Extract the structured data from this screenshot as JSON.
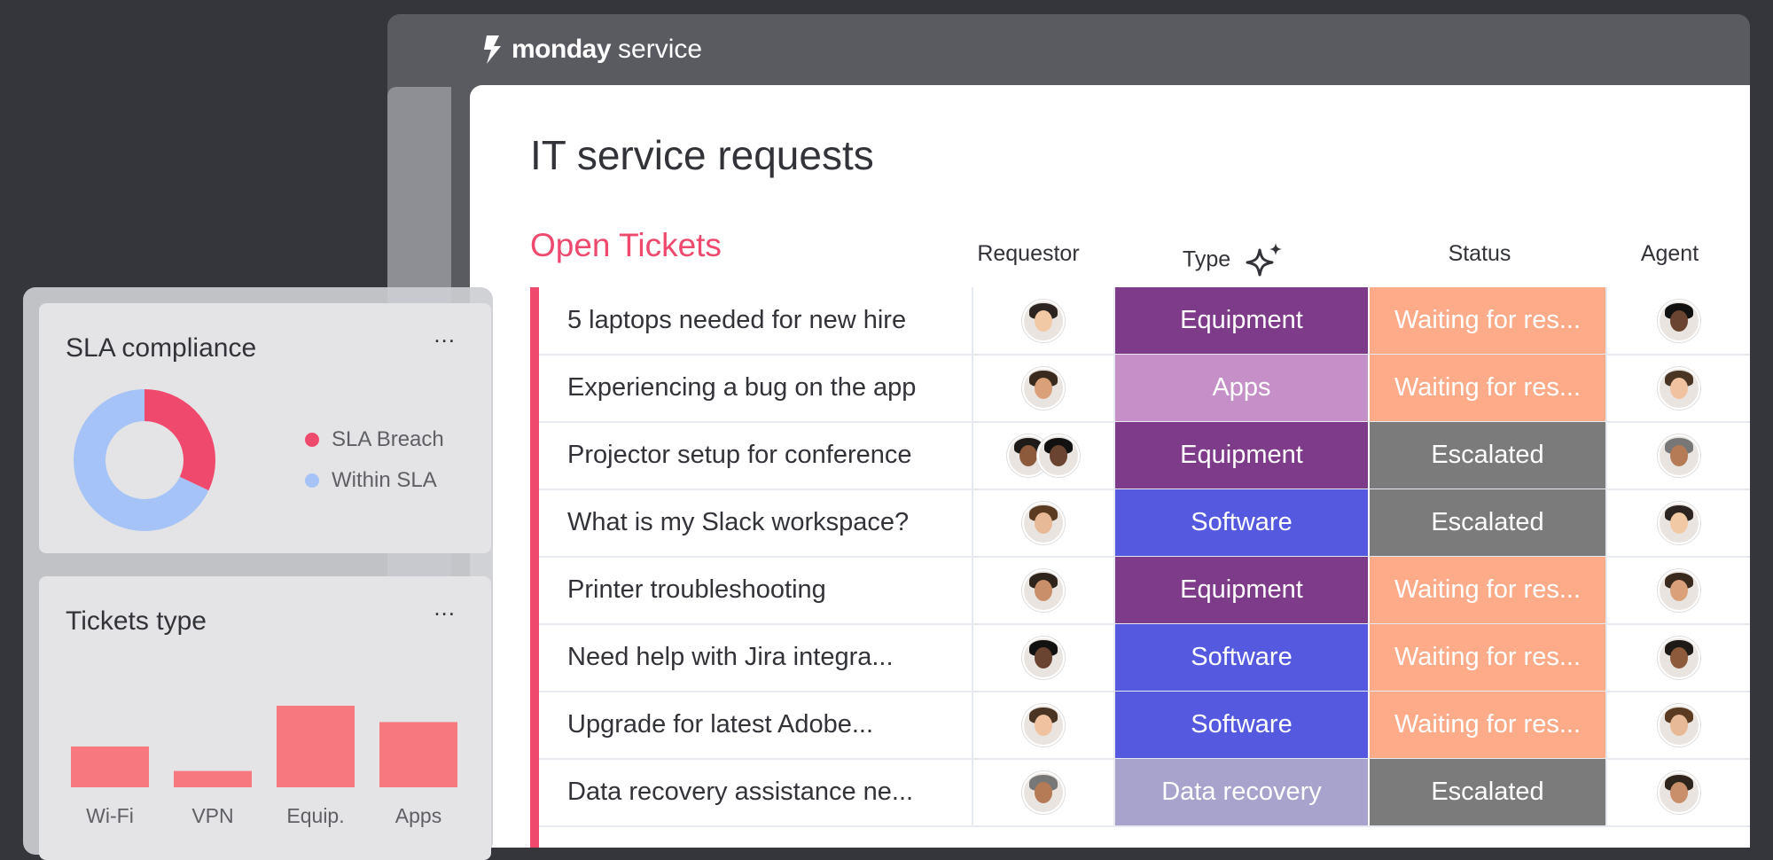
{
  "app": {
    "brand": "monday",
    "product": "service"
  },
  "board": {
    "title": "IT service requests"
  },
  "group": {
    "title": "Open Tickets"
  },
  "columns": {
    "requestor": "Requestor",
    "type": "Type",
    "status": "Status",
    "agent": "Agent"
  },
  "rows": [
    {
      "name": "5 laptops needed for new hire",
      "type": "Equipment",
      "status": "Waiting for res..."
    },
    {
      "name": "Experiencing a bug on the app",
      "type": "Apps",
      "status": "Waiting for res..."
    },
    {
      "name": "Projector setup for conference",
      "type": "Equipment",
      "status": "Escalated"
    },
    {
      "name": "What is my Slack workspace?",
      "type": "Software",
      "status": "Escalated"
    },
    {
      "name": "Printer troubleshooting",
      "type": "Equipment",
      "status": "Waiting for res..."
    },
    {
      "name": "Need help with Jira integra...",
      "type": "Software",
      "status": "Waiting for res..."
    },
    {
      "name": "Upgrade for latest Adobe...",
      "type": "Software",
      "status": "Waiting for res..."
    },
    {
      "name": "Data recovery assistance ne...",
      "type": "Data recovery",
      "status": "Escalated"
    }
  ],
  "colors": {
    "Equipment": "#7e3b8a",
    "Apps": "#c58fc8",
    "Software": "#5559df",
    "Data recovery": "#a7a3cc",
    "Waiting for res...": "#fdab88",
    "Escalated": "#7b7b7b",
    "accent": "#ef4a6e"
  },
  "sla": {
    "title": "SLA compliance",
    "menu": "...",
    "legend": [
      "SLA Breach",
      "Within SLA"
    ],
    "breach_fraction": 0.32,
    "colors": [
      "#ef4a6e",
      "#a5c3f6"
    ]
  },
  "tickets_type": {
    "title": "Tickets type",
    "menu": "..."
  },
  "chart_data": {
    "type": "bar",
    "title": "Tickets type",
    "categories": [
      "Wi-Fi",
      "VPN",
      "Equip.",
      "Apps"
    ],
    "values": [
      5,
      2,
      10,
      8
    ],
    "ylim": [
      0,
      10
    ]
  }
}
